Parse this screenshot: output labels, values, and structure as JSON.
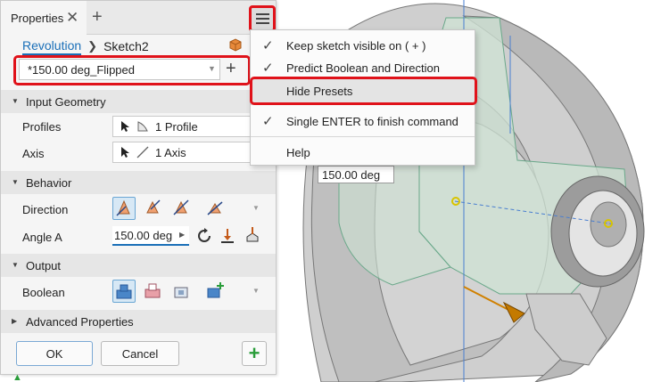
{
  "panel": {
    "tab_title": "Properties",
    "tab_close": "✕",
    "tab_add": "+",
    "breadcrumb": {
      "link": "Revolution",
      "current": "Sketch2"
    },
    "preset": {
      "value": "*150.00 deg_Flipped",
      "add": "+"
    },
    "input_geometry": {
      "title": "Input Geometry",
      "profiles_label": "Profiles",
      "profiles_value": "1 Profile",
      "axis_label": "Axis",
      "axis_value": "1 Axis"
    },
    "behavior": {
      "title": "Behavior",
      "direction_label": "Direction",
      "angle_label": "Angle A",
      "angle_value": "150.00 deg"
    },
    "output": {
      "title": "Output",
      "boolean_label": "Boolean"
    },
    "advanced": {
      "title": "Advanced Properties"
    },
    "buttons": {
      "ok": "OK",
      "cancel": "Cancel",
      "add": "+"
    }
  },
  "menu": {
    "items": [
      {
        "label": "Keep sketch visible on ( + )",
        "checked": true
      },
      {
        "label": "Predict Boolean and Direction",
        "checked": true
      },
      {
        "label": "Hide Presets",
        "checked": false
      },
      {
        "label": "Single ENTER to finish command",
        "checked": true
      },
      {
        "label": "Help",
        "checked": false
      }
    ],
    "check_glyph": "✓"
  },
  "viewport": {
    "dimension_label": "150.00 deg"
  },
  "colors": {
    "accent": "#1a6fb8",
    "highlight": "#e0121a",
    "model_gray": "#c9c9c9",
    "preview_green": "#cfe3d4"
  }
}
